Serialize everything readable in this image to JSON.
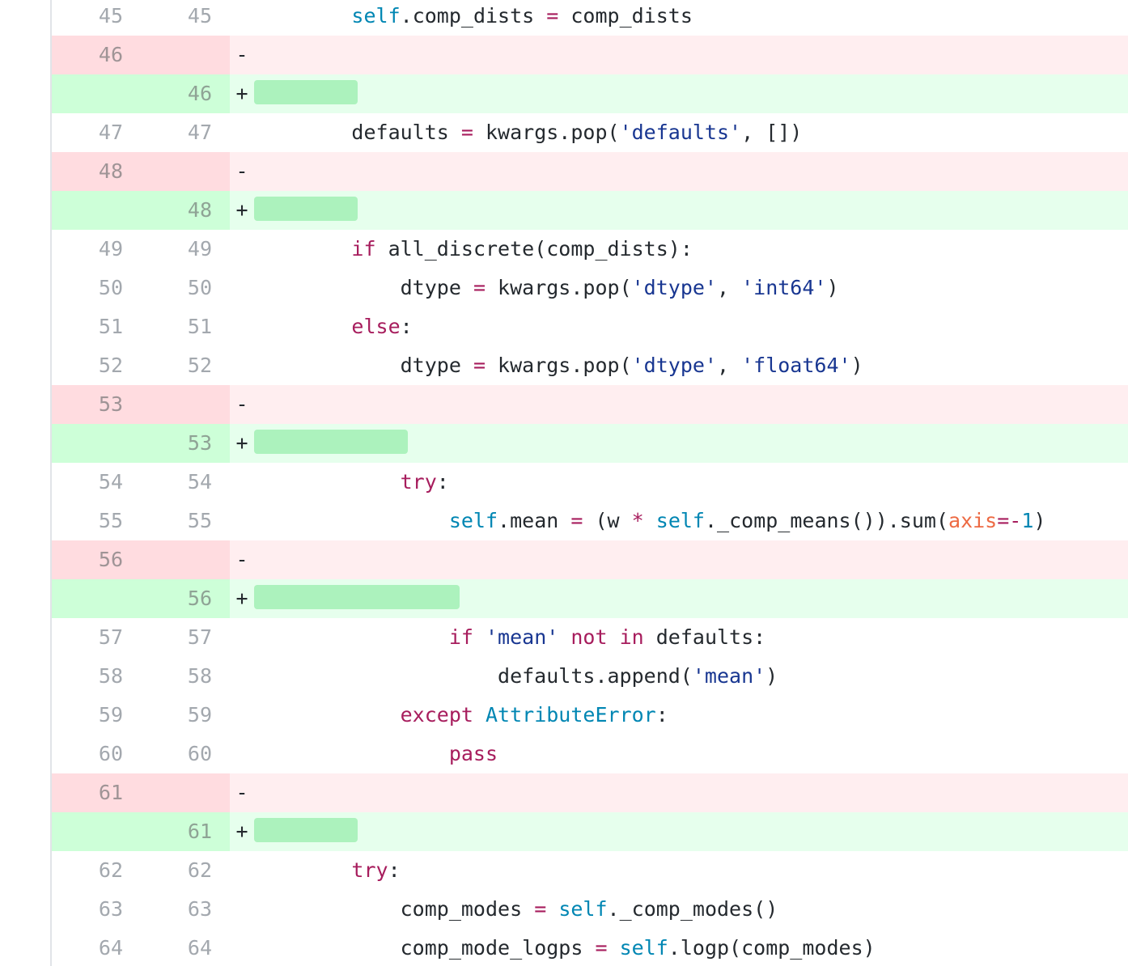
{
  "colors": {
    "deletion_bg": "#ffeef0",
    "deletion_num_bg": "#ffdce0",
    "addition_bg": "#e6ffed",
    "addition_num_bg": "#cdffd8",
    "addition_highlight": "#acf2bd",
    "keyword": "#a71d5d",
    "builtin": "#0086b3",
    "string": "#183691",
    "param": "#ed6a43"
  },
  "rows": [
    {
      "type": "context",
      "old": "45",
      "new": "45",
      "marker": "",
      "indent": "        ",
      "tokens": [
        [
          "self",
          "self"
        ],
        [
          "t",
          ".comp_dists "
        ],
        [
          "op",
          "="
        ],
        [
          "t",
          " comp_dists"
        ]
      ]
    },
    {
      "type": "del",
      "old": "46",
      "new": "",
      "marker": "-",
      "indent": "",
      "tokens": []
    },
    {
      "type": "add",
      "old": "",
      "new": "46",
      "marker": "+",
      "indent": "",
      "hl": 128,
      "tokens": []
    },
    {
      "type": "context",
      "old": "47",
      "new": "47",
      "marker": "",
      "indent": "        ",
      "tokens": [
        [
          "t",
          "defaults "
        ],
        [
          "op",
          "="
        ],
        [
          "t",
          " kwargs.pop("
        ],
        [
          "str",
          "'defaults'"
        ],
        [
          "t",
          ", [])"
        ]
      ]
    },
    {
      "type": "del",
      "old": "48",
      "new": "",
      "marker": "-",
      "indent": "",
      "tokens": []
    },
    {
      "type": "add",
      "old": "",
      "new": "48",
      "marker": "+",
      "indent": "",
      "hl": 128,
      "tokens": []
    },
    {
      "type": "context",
      "old": "49",
      "new": "49",
      "marker": "",
      "indent": "        ",
      "tokens": [
        [
          "kw",
          "if"
        ],
        [
          "t",
          " all_discrete(comp_dists):"
        ]
      ]
    },
    {
      "type": "context",
      "old": "50",
      "new": "50",
      "marker": "",
      "indent": "            ",
      "tokens": [
        [
          "t",
          "dtype "
        ],
        [
          "op",
          "="
        ],
        [
          "t",
          " kwargs.pop("
        ],
        [
          "str",
          "'dtype'"
        ],
        [
          "t",
          ", "
        ],
        [
          "str",
          "'int64'"
        ],
        [
          "t",
          ")"
        ]
      ]
    },
    {
      "type": "context",
      "old": "51",
      "new": "51",
      "marker": "",
      "indent": "        ",
      "tokens": [
        [
          "kw",
          "else"
        ],
        [
          "t",
          ":"
        ]
      ]
    },
    {
      "type": "context",
      "old": "52",
      "new": "52",
      "marker": "",
      "indent": "            ",
      "tokens": [
        [
          "t",
          "dtype "
        ],
        [
          "op",
          "="
        ],
        [
          "t",
          " kwargs.pop("
        ],
        [
          "str",
          "'dtype'"
        ],
        [
          "t",
          ", "
        ],
        [
          "str",
          "'float64'"
        ],
        [
          "t",
          ")"
        ]
      ]
    },
    {
      "type": "del",
      "old": "53",
      "new": "",
      "marker": "-",
      "indent": "",
      "tokens": []
    },
    {
      "type": "add",
      "old": "",
      "new": "53",
      "marker": "+",
      "indent": "",
      "hl": 190,
      "tokens": []
    },
    {
      "type": "context",
      "old": "54",
      "new": "54",
      "marker": "",
      "indent": "            ",
      "tokens": [
        [
          "kw",
          "try"
        ],
        [
          "t",
          ":"
        ]
      ]
    },
    {
      "type": "context",
      "old": "55",
      "new": "55",
      "marker": "",
      "indent": "                ",
      "tokens": [
        [
          "self",
          "self"
        ],
        [
          "t",
          ".mean "
        ],
        [
          "op",
          "="
        ],
        [
          "t",
          " (w "
        ],
        [
          "op",
          "*"
        ],
        [
          "t",
          " "
        ],
        [
          "self",
          "self"
        ],
        [
          "t",
          "._comp_means()).sum("
        ],
        [
          "arg",
          "axis"
        ],
        [
          "op",
          "="
        ],
        [
          "op",
          "-"
        ],
        [
          "numl",
          "1"
        ],
        [
          "t",
          ")"
        ]
      ]
    },
    {
      "type": "del",
      "old": "56",
      "new": "",
      "marker": "-",
      "indent": "",
      "tokens": []
    },
    {
      "type": "add",
      "old": "",
      "new": "56",
      "marker": "+",
      "indent": "",
      "hl": 254,
      "tokens": []
    },
    {
      "type": "context",
      "old": "57",
      "new": "57",
      "marker": "",
      "indent": "                ",
      "tokens": [
        [
          "kw",
          "if"
        ],
        [
          "t",
          " "
        ],
        [
          "str",
          "'mean'"
        ],
        [
          "t",
          " "
        ],
        [
          "kw",
          "not"
        ],
        [
          "t",
          " "
        ],
        [
          "kw",
          "in"
        ],
        [
          "t",
          " defaults:"
        ]
      ]
    },
    {
      "type": "context",
      "old": "58",
      "new": "58",
      "marker": "",
      "indent": "                    ",
      "tokens": [
        [
          "t",
          "defaults.append("
        ],
        [
          "str",
          "'mean'"
        ],
        [
          "t",
          ")"
        ]
      ]
    },
    {
      "type": "context",
      "old": "59",
      "new": "59",
      "marker": "",
      "indent": "            ",
      "tokens": [
        [
          "kw",
          "except"
        ],
        [
          "t",
          " "
        ],
        [
          "cls",
          "AttributeError"
        ],
        [
          "t",
          ":"
        ]
      ]
    },
    {
      "type": "context",
      "old": "60",
      "new": "60",
      "marker": "",
      "indent": "                ",
      "tokens": [
        [
          "kw",
          "pass"
        ]
      ]
    },
    {
      "type": "del",
      "old": "61",
      "new": "",
      "marker": "-",
      "indent": "",
      "tokens": []
    },
    {
      "type": "add",
      "old": "",
      "new": "61",
      "marker": "+",
      "indent": "",
      "hl": 128,
      "tokens": []
    },
    {
      "type": "context",
      "old": "62",
      "new": "62",
      "marker": "",
      "indent": "        ",
      "tokens": [
        [
          "kw",
          "try"
        ],
        [
          "t",
          ":"
        ]
      ]
    },
    {
      "type": "context",
      "old": "63",
      "new": "63",
      "marker": "",
      "indent": "            ",
      "tokens": [
        [
          "t",
          "comp_modes "
        ],
        [
          "op",
          "="
        ],
        [
          "t",
          " "
        ],
        [
          "self",
          "self"
        ],
        [
          "t",
          "._comp_modes()"
        ]
      ]
    },
    {
      "type": "context",
      "old": "64",
      "new": "64",
      "marker": "",
      "indent": "            ",
      "tokens": [
        [
          "t",
          "comp_mode_logps "
        ],
        [
          "op",
          "="
        ],
        [
          "t",
          " "
        ],
        [
          "self",
          "self"
        ],
        [
          "t",
          ".logp(comp_modes)"
        ]
      ]
    }
  ]
}
